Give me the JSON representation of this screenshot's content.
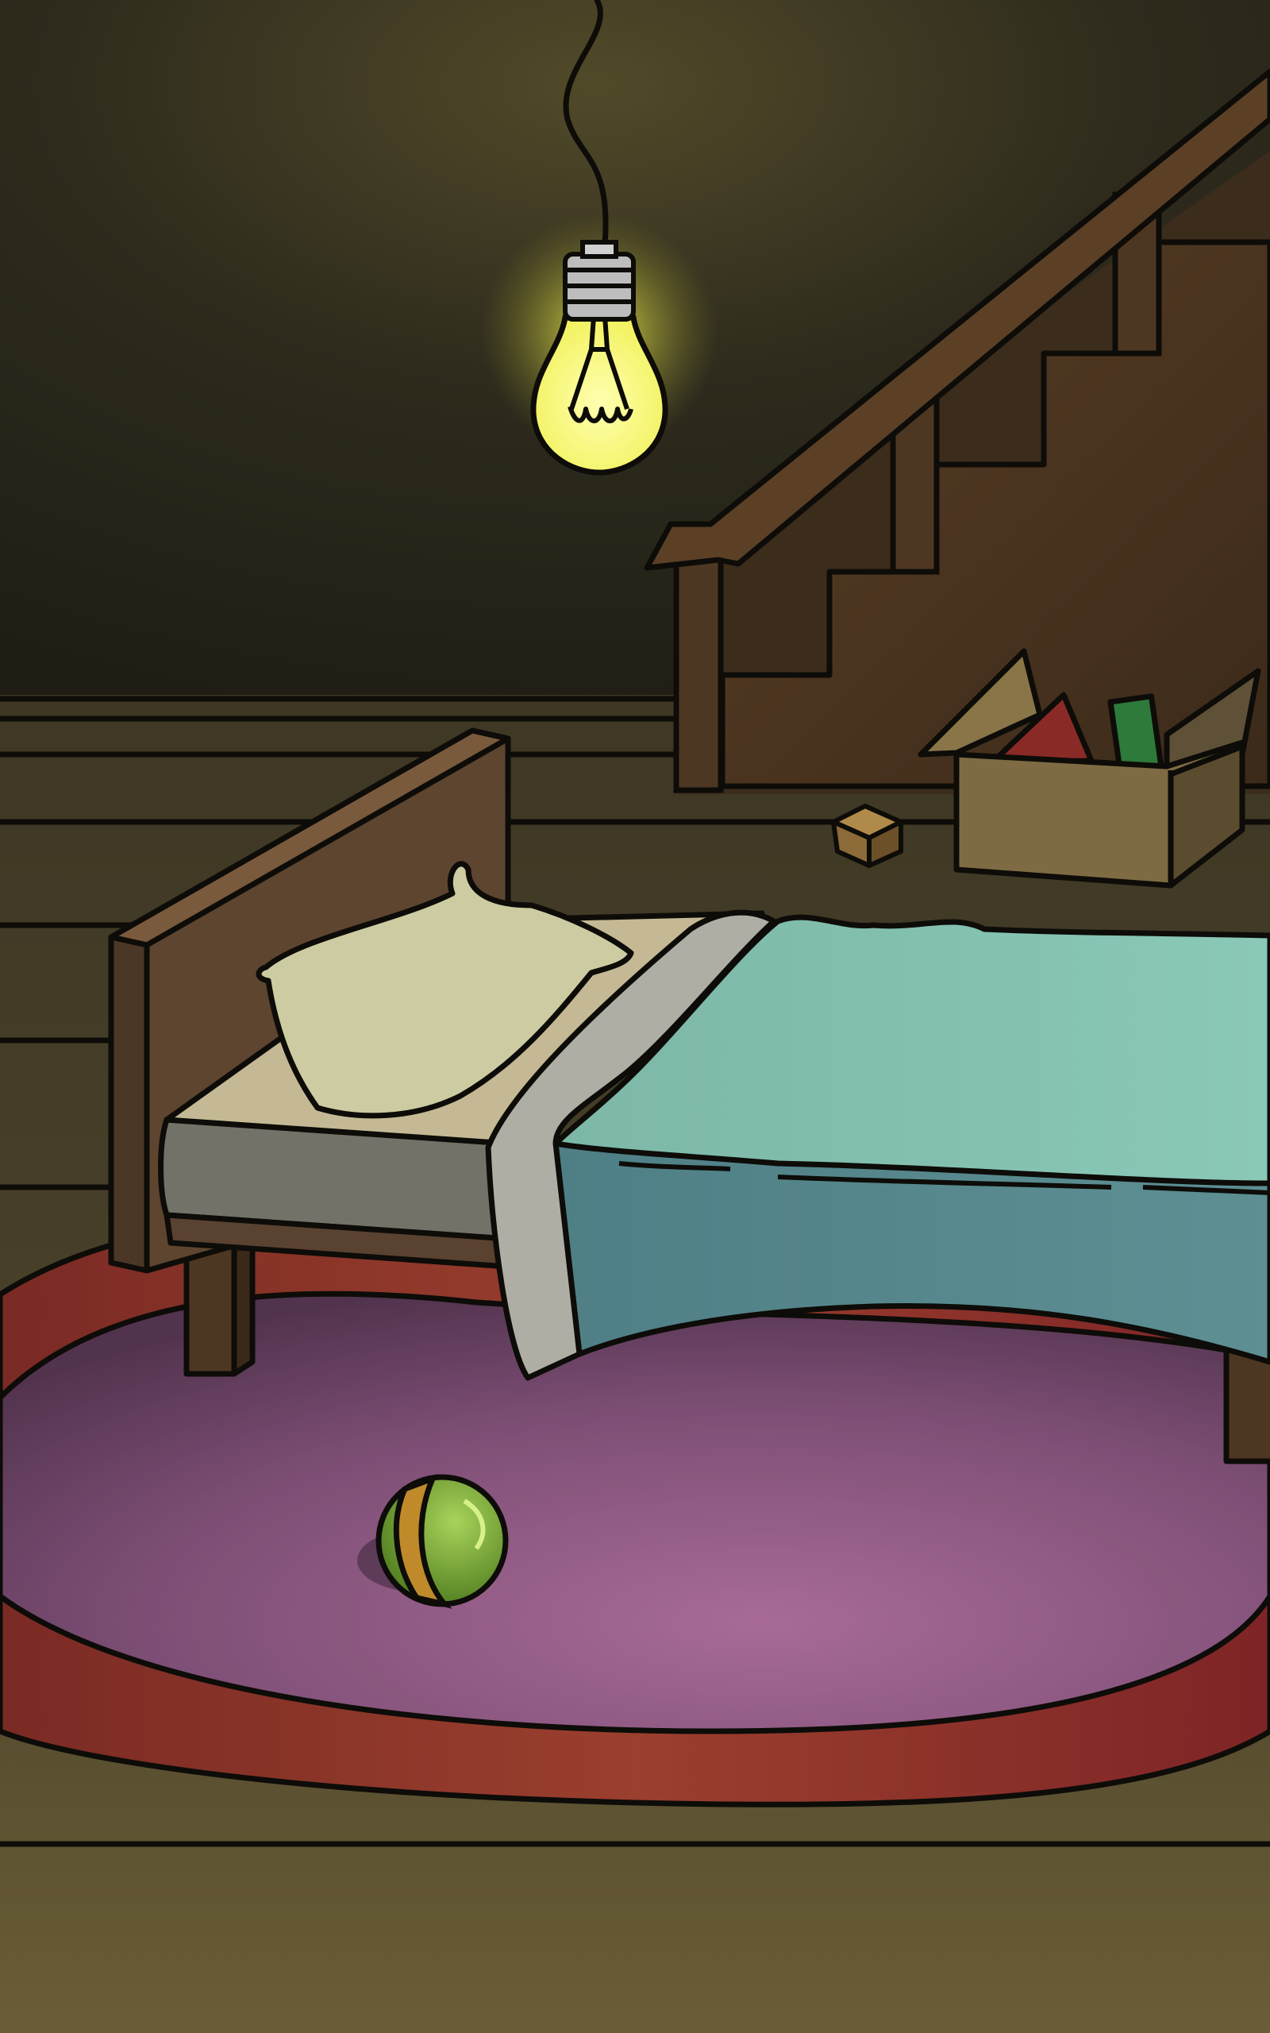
{
  "scene": {
    "type": "point-and-click-room",
    "description_free": true,
    "objects": [
      {
        "name": "light-bulb",
        "interactable": true
      },
      {
        "name": "staircase",
        "interactable": true
      },
      {
        "name": "toy-box",
        "interactable": true
      },
      {
        "name": "small-cube",
        "interactable": true
      },
      {
        "name": "bed",
        "interactable": true
      },
      {
        "name": "pillow",
        "interactable": true
      },
      {
        "name": "blanket",
        "interactable": true
      },
      {
        "name": "rug",
        "interactable": false
      },
      {
        "name": "ball",
        "interactable": true
      }
    ]
  },
  "colors": {
    "wall_dark": "#26231a",
    "wall_mid": "#3a3522",
    "floor": "#6a5c36",
    "bulb_glow": "#f4f46a",
    "stairs_wood": "#4a3421",
    "bed_wood": "#5e4530",
    "mattress": "#6e6e6e",
    "sheet": "#c9c6a6",
    "blanket_top": "#86bfae",
    "blanket_side": "#5d8a8f",
    "rug_outer": "#8a2f26",
    "rug_inner": "#94628a",
    "ball_green": "#7aa334",
    "ball_stripe": "#c08a2a",
    "box": "#7e6b43",
    "outline": "#0d0c08"
  }
}
